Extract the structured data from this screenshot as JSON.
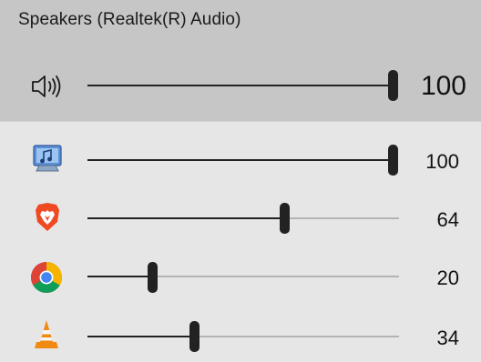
{
  "device": {
    "title": "Speakers (Realtek(R) Audio)"
  },
  "master": {
    "icon": "speaker-icon",
    "value_label": "100",
    "level": 100
  },
  "apps": [
    {
      "name": "system-sounds",
      "icon": "system-sounds-icon",
      "value_label": "100",
      "level": 100
    },
    {
      "name": "brave",
      "icon": "brave-icon",
      "value_label": "64",
      "level": 64
    },
    {
      "name": "chrome",
      "icon": "chrome-icon",
      "value_label": "20",
      "level": 20
    },
    {
      "name": "vlc",
      "icon": "vlc-icon",
      "value_label": "34",
      "level": 34
    }
  ],
  "colors": {
    "header_bg": "#c6c6c6",
    "panel_bg": "#e6e6e6",
    "slider_fill": "#222222",
    "slider_track": "#b4b4b4"
  }
}
